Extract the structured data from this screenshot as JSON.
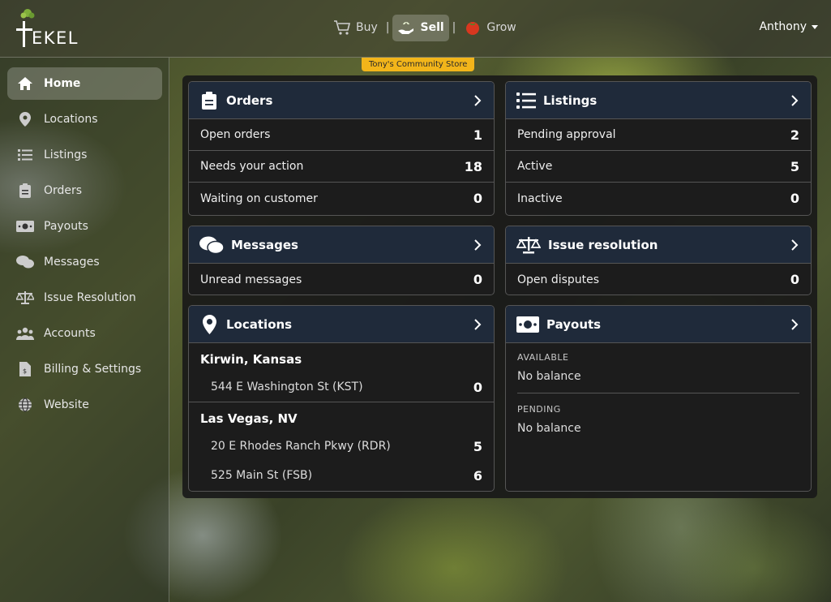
{
  "brand": {
    "name": "EKEL"
  },
  "modes": [
    {
      "label": "Buy",
      "icon": "cart-icon",
      "active": false
    },
    {
      "label": "Sell",
      "icon": "hand-plant-icon",
      "active": true
    },
    {
      "label": "Grow",
      "icon": "tomato-icon",
      "active": false
    }
  ],
  "user": {
    "name": "Anthony"
  },
  "store_badge": "Tony's Community Store",
  "sidebar": {
    "items": [
      {
        "label": "Home",
        "icon": "home-icon"
      },
      {
        "label": "Locations",
        "icon": "map-pin-icon"
      },
      {
        "label": "Listings",
        "icon": "list-icon"
      },
      {
        "label": "Orders",
        "icon": "clipboard-icon"
      },
      {
        "label": "Payouts",
        "icon": "money-icon"
      },
      {
        "label": "Messages",
        "icon": "chat-icon"
      },
      {
        "label": "Issue Resolution",
        "icon": "scale-icon"
      },
      {
        "label": "Accounts",
        "icon": "users-icon"
      },
      {
        "label": "Billing & Settings",
        "icon": "invoice-icon"
      },
      {
        "label": "Website",
        "icon": "globe-icon"
      }
    ]
  },
  "orders": {
    "title": "Orders",
    "rows": [
      {
        "label": "Open orders",
        "value": "1"
      },
      {
        "label": "Needs your action",
        "value": "18"
      },
      {
        "label": "Waiting on customer",
        "value": "0"
      }
    ]
  },
  "listings": {
    "title": "Listings",
    "rows": [
      {
        "label": "Pending approval",
        "value": "2"
      },
      {
        "label": "Active",
        "value": "5"
      },
      {
        "label": "Inactive",
        "value": "0"
      }
    ]
  },
  "messages": {
    "title": "Messages",
    "rows": [
      {
        "label": "Unread messages",
        "value": "0"
      }
    ]
  },
  "issues": {
    "title": "Issue resolution",
    "rows": [
      {
        "label": "Open disputes",
        "value": "0"
      }
    ]
  },
  "locations": {
    "title": "Locations",
    "groups": [
      {
        "city": "Kirwin, Kansas",
        "stores": [
          {
            "name": "544 E Washington St (KST)",
            "value": "0"
          }
        ]
      },
      {
        "city": "Las Vegas, NV",
        "stores": [
          {
            "name": "20 E Rhodes Ranch Pkwy (RDR)",
            "value": "5"
          },
          {
            "name": "525 Main St (FSB)",
            "value": "6"
          }
        ]
      }
    ]
  },
  "payouts": {
    "title": "Payouts",
    "available_label": "AVAILABLE",
    "available_value": "No balance",
    "pending_label": "PENDING",
    "pending_value": "No balance"
  }
}
